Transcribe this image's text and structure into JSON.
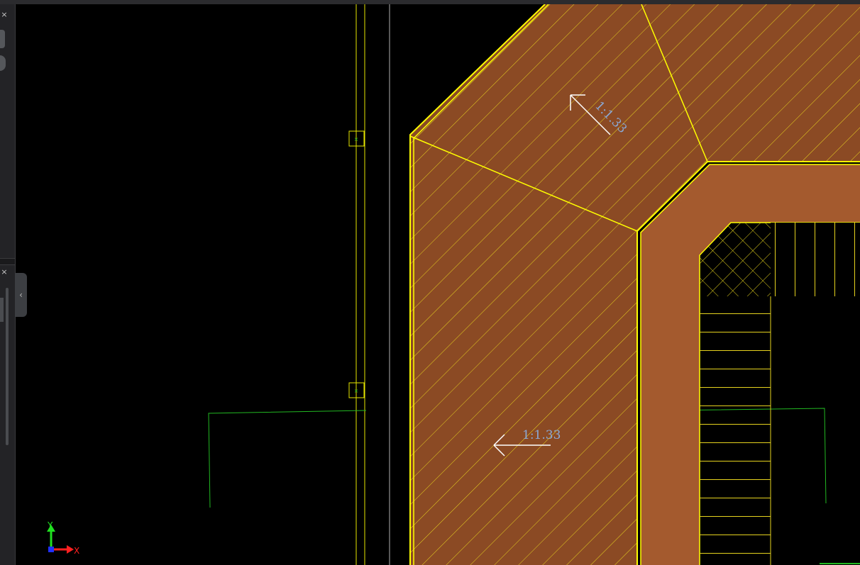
{
  "panel": {
    "close_glyph": "×"
  },
  "collapse_tab": {
    "glyph": "‹"
  },
  "annotations": {
    "slope_upper": "1:1.33",
    "slope_left": "1:1.33"
  },
  "ucs": {
    "x_label": "X",
    "y_label": "Y"
  },
  "colors": {
    "background": "#000000",
    "panel": "#232326",
    "roof_fill": "#8b4a24",
    "wall_fill": "#a45a2e",
    "outline": "#ffff00",
    "hatch": "#e6d31e",
    "green_lines": "#22b822",
    "slope_text": "#8aa9d6",
    "arrow": "#ffffff",
    "axis_x": "#ff2020",
    "axis_y": "#20e020",
    "axis_origin": "#2030ff"
  }
}
